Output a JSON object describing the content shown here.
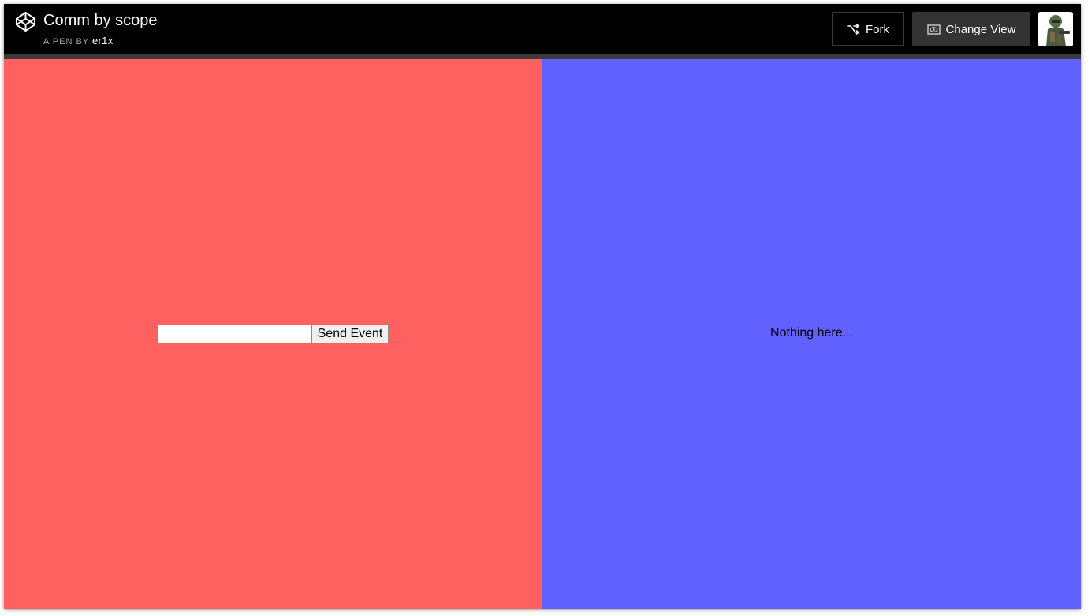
{
  "header": {
    "title": "Comm by scope",
    "byline_prefix": "A PEN BY",
    "author": "er1x",
    "fork_label": "Fork",
    "change_view_label": "Change View",
    "logo_icon": "codepen-logo-icon",
    "fork_icon": "fork-icon",
    "change_view_icon": "eye-icon",
    "avatar_icon": "user-avatar-icon"
  },
  "left_pane": {
    "color": "#ff6161",
    "input_value": "",
    "send_label": "Send Event"
  },
  "right_pane": {
    "color": "#6161ff",
    "status_text": "Nothing here..."
  }
}
